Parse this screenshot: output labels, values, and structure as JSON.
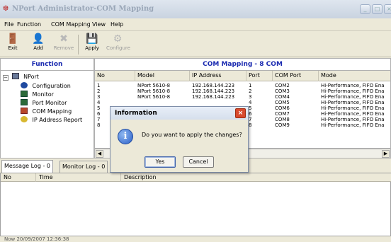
{
  "window": {
    "title": "NPort Administrator-COM Mapping"
  },
  "menu": [
    "File",
    "Function",
    "COM Mapping",
    "View",
    "Help"
  ],
  "toolbar": {
    "exit": "Exit",
    "add": "Add",
    "remove": "Remove",
    "apply": "Apply",
    "configure": "Configure"
  },
  "function_panel": {
    "header": "Function",
    "root": "NPort",
    "items": [
      "Configuration",
      "Monitor",
      "Port Monitor",
      "COM Mapping",
      "IP Address Report"
    ]
  },
  "main": {
    "header": "COM Mapping - 8 COM",
    "columns": [
      "No",
      "Model",
      "IP Address",
      "Port",
      "COM Port",
      "Mode"
    ],
    "rows": [
      {
        "no": "1",
        "model": "NPort 5610-8",
        "ip": "192.168.144.223",
        "port": "1",
        "com": "COM2",
        "mode": "Hi-Performance, FIFO Ena"
      },
      {
        "no": "2",
        "model": "NPort 5610-8",
        "ip": "192.168.144.223",
        "port": "2",
        "com": "COM3",
        "mode": "Hi-Performance, FIFO Ena"
      },
      {
        "no": "3",
        "model": "NPort 5610-8",
        "ip": "192.168.144.223",
        "port": "3",
        "com": "COM4",
        "mode": "Hi-Performance, FIFO Ena"
      },
      {
        "no": "4",
        "model": "",
        "ip": "",
        "port": "4",
        "com": "COM5",
        "mode": "Hi-Performance, FIFO Ena"
      },
      {
        "no": "5",
        "model": "",
        "ip": "",
        "port": "5",
        "com": "COM6",
        "mode": "Hi-Performance, FIFO Ena"
      },
      {
        "no": "6",
        "model": "",
        "ip": "",
        "port": "6",
        "com": "COM7",
        "mode": "Hi-Performance, FIFO Ena"
      },
      {
        "no": "7",
        "model": "",
        "ip": "",
        "port": "7",
        "com": "COM8",
        "mode": "Hi-Performance, FIFO Ena"
      },
      {
        "no": "8",
        "model": "",
        "ip": "",
        "port": "8",
        "com": "COM9",
        "mode": "Hi-Performance, FIFO Ena"
      }
    ]
  },
  "log_tabs": [
    "Message Log - 0",
    "Monitor Log - 0"
  ],
  "log_columns": [
    "No",
    "Time",
    "Description"
  ],
  "status": "Now 20/09/2007 12:36:38",
  "dialog": {
    "title": "Information",
    "message": "Do you want to apply the changes?",
    "yes": "Yes",
    "cancel": "Cancel"
  },
  "colors": {
    "header_text": "#1a2ab0",
    "close_button": "#d84a2e"
  }
}
